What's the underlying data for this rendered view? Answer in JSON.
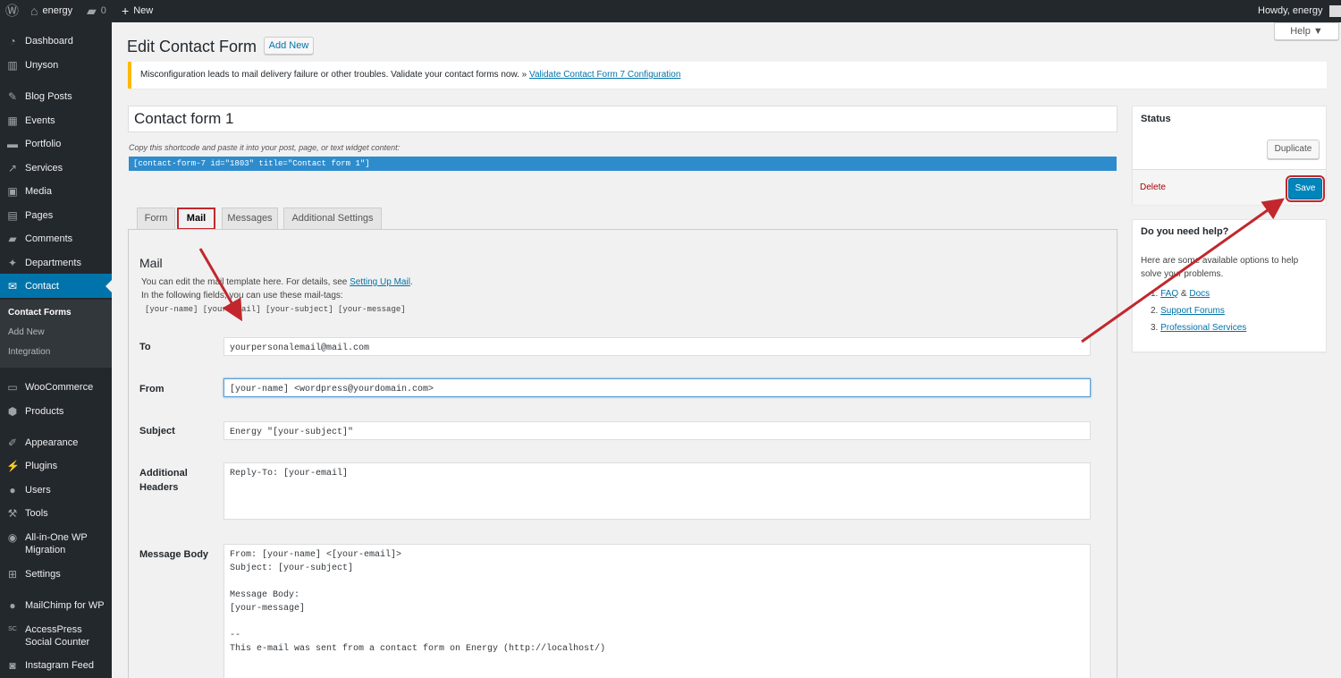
{
  "adminbar": {
    "site_name": "energy",
    "comments_count": "0",
    "new_label": "New",
    "howdy": "Howdy, energy"
  },
  "sidebar": {
    "items": [
      {
        "label": "Dashboard",
        "icon": "dashboard-icon",
        "glyph": "◔"
      },
      {
        "label": "Unyson",
        "icon": "unyson-icon",
        "glyph": "▥"
      },
      {
        "label": "Blog Posts",
        "icon": "pin-icon",
        "glyph": "✎"
      },
      {
        "label": "Events",
        "icon": "calendar-icon",
        "glyph": "▦"
      },
      {
        "label": "Portfolio",
        "icon": "folder-icon",
        "glyph": "▬"
      },
      {
        "label": "Services",
        "icon": "wrench-icon",
        "glyph": "↗"
      },
      {
        "label": "Media",
        "icon": "media-icon",
        "glyph": "▣"
      },
      {
        "label": "Pages",
        "icon": "pages-icon",
        "glyph": "▤"
      },
      {
        "label": "Comments",
        "icon": "comment-icon",
        "glyph": "▰"
      },
      {
        "label": "Departments",
        "icon": "pin-icon",
        "glyph": "✦"
      },
      {
        "label": "Contact",
        "icon": "mail-icon",
        "glyph": "✉"
      },
      {
        "label": "WooCommerce",
        "icon": "woocommerce-icon",
        "glyph": "▭"
      },
      {
        "label": "Products",
        "icon": "box-icon",
        "glyph": "⬢"
      },
      {
        "label": "Appearance",
        "icon": "brush-icon",
        "glyph": "✐"
      },
      {
        "label": "Plugins",
        "icon": "plug-icon",
        "glyph": "⚡"
      },
      {
        "label": "Users",
        "icon": "user-icon",
        "glyph": "●"
      },
      {
        "label": "Tools",
        "icon": "tools-icon",
        "glyph": "⚒"
      },
      {
        "label": "All-in-One WP Migration",
        "icon": "migration-icon",
        "glyph": "◉"
      },
      {
        "label": "Settings",
        "icon": "settings-icon",
        "glyph": "⊞"
      },
      {
        "label": "MailChimp for WP",
        "icon": "mailchimp-icon",
        "glyph": "●"
      },
      {
        "label": "AccessPress Social Counter",
        "icon": "sc-icon",
        "glyph": "SC"
      },
      {
        "label": "Instagram Feed",
        "icon": "instagram-icon",
        "glyph": "◙"
      }
    ],
    "submenu": [
      "Contact Forms",
      "Add New",
      "Integration"
    ]
  },
  "page": {
    "title": "Edit Contact Form",
    "add_new": "Add New",
    "help": "Help ▼",
    "notice_text": "Misconfiguration leads to mail delivery failure or other troubles. Validate your contact forms now. » ",
    "notice_link": "Validate Contact Form 7 Configuration",
    "form_title": "Contact form 1",
    "shortcode_hint": "Copy this shortcode and paste it into your post, page, or text widget content:",
    "shortcode": "[contact-form-7 id=\"1803\" title=\"Contact form 1\"]"
  },
  "tabs": [
    "Form",
    "Mail",
    "Messages",
    "Additional Settings"
  ],
  "mail": {
    "heading": "Mail",
    "intro_1": "You can edit the mail template here. For details, see ",
    "intro_link": "Setting Up Mail",
    "intro_2": "In the following fields, you can use these mail-tags:",
    "tags": "[your-name] [your-email] [your-subject] [your-message]",
    "to_label": "To",
    "to_value": "yourpersonalemail@mail.com",
    "from_label": "From",
    "from_value": "[your-name] <wordpress@yourdomain.com>",
    "subject_label": "Subject",
    "subject_value": "Energy \"[your-subject]\"",
    "headers_label_1": "Additional",
    "headers_label_2": "Headers",
    "headers_value": "Reply-To: [your-email]",
    "body_label": "Message Body",
    "body_value": "From: [your-name] <[your-email]>\nSubject: [your-subject]\n\nMessage Body:\n[your-message]\n\n--\nThis e-mail was sent from a contact form on Energy (http://localhost/)"
  },
  "status_box": {
    "title": "Status",
    "duplicate": "Duplicate",
    "delete": "Delete",
    "save": "Save"
  },
  "help_box": {
    "title": "Do you need help?",
    "text": "Here are some available options to help solve your problems.",
    "links": [
      "FAQ",
      "Docs",
      "Support Forums",
      "Professional Services"
    ],
    "amp": "&"
  },
  "colors": {
    "accent": "#0073aa",
    "annotation": "#c1272d",
    "shortcode_bg": "#2e8ccd"
  }
}
